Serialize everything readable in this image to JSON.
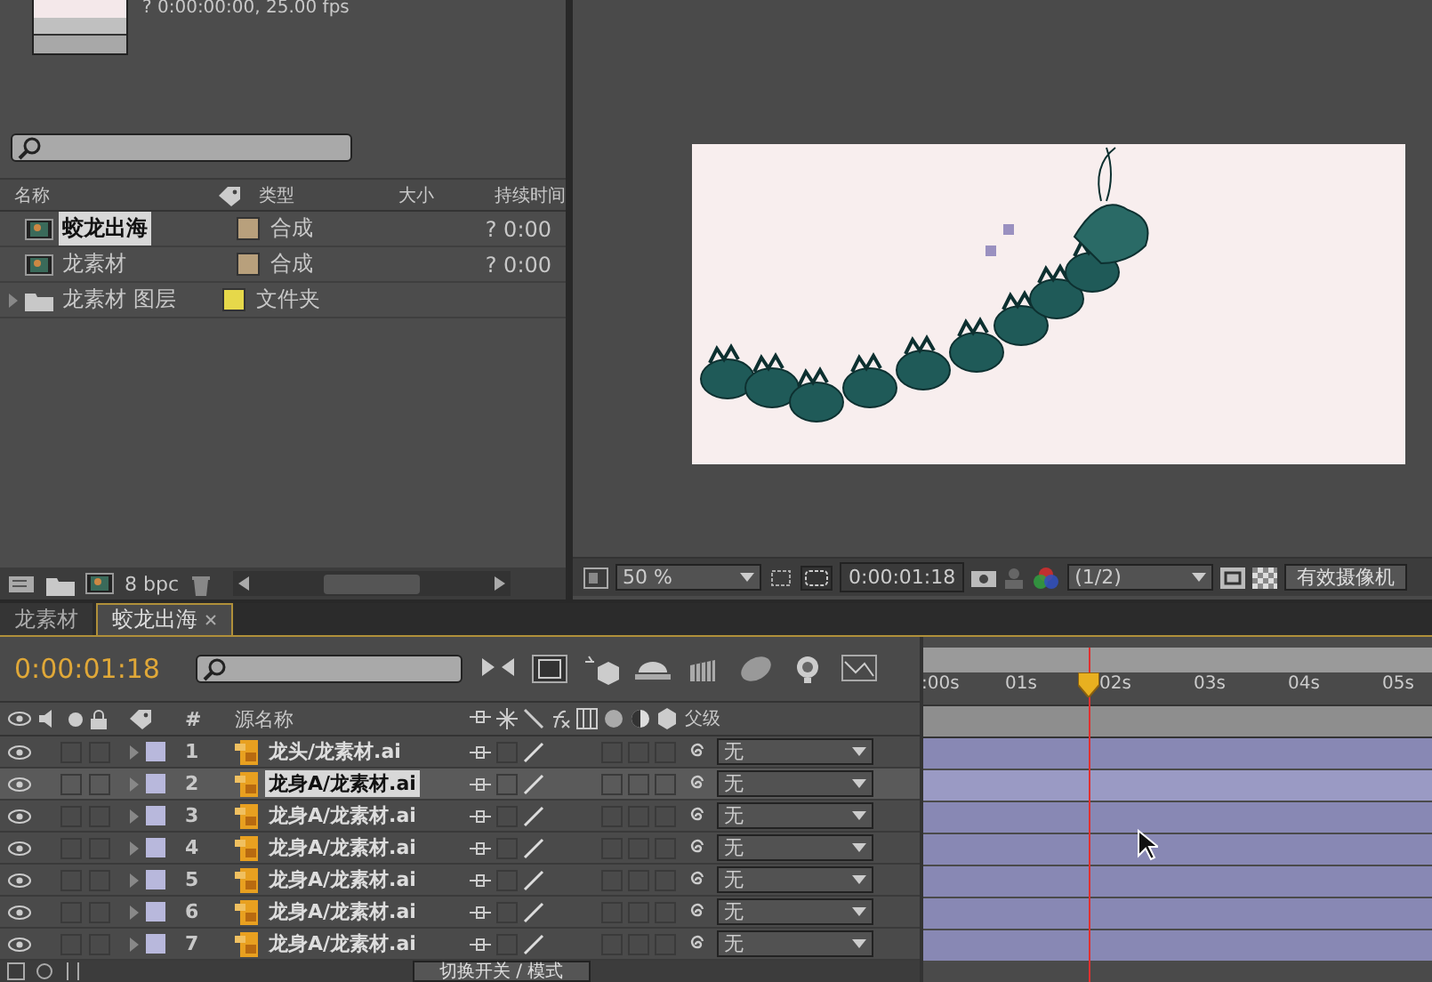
{
  "project": {
    "comp_info": "? 0:00:00:00, 25.00 fps",
    "columns": [
      "名称",
      "类型",
      "大小",
      "持续时间"
    ],
    "items": [
      {
        "name": "蛟龙出海",
        "kind": "comp",
        "type": "合成",
        "color": "#b8a07c",
        "duration": "? 0:00",
        "selected": true
      },
      {
        "name": "龙素材",
        "kind": "comp",
        "type": "合成",
        "color": "#b8a07c",
        "duration": "? 0:00",
        "selected": false
      },
      {
        "name": "龙素材 图层",
        "kind": "folder",
        "type": "文件夹",
        "color": "#e6d84a",
        "expanded": false,
        "selected": false
      }
    ],
    "bit_depth": "8 bpc"
  },
  "viewer": {
    "zoom": "50 %",
    "time": "0:00:01:18",
    "resolution": "(1/2)",
    "camera": "有效摄像机"
  },
  "timeline": {
    "tabs": [
      {
        "label": "龙素材",
        "selected": false
      },
      {
        "label": "蛟龙出海",
        "selected": true
      }
    ],
    "time": "0:00:01:18",
    "ruler": [
      ":00s",
      "01s",
      "02s",
      "03s",
      "04s",
      "05s"
    ],
    "playhead": {
      "level": 0.325
    },
    "columns": {
      "number": "#",
      "source_name": "源名称",
      "parent": "父级"
    },
    "layers": [
      {
        "number": "1",
        "name": "龙头/龙素材.ai",
        "visible": true,
        "selected": false,
        "parent": "无"
      },
      {
        "number": "2",
        "name": "龙身A/龙素材.ai",
        "visible": true,
        "selected": true,
        "parent": "无"
      },
      {
        "number": "3",
        "name": "龙身A/龙素材.ai",
        "visible": true,
        "selected": false,
        "parent": "无"
      },
      {
        "number": "4",
        "name": "龙身A/龙素材.ai",
        "visible": true,
        "selected": false,
        "parent": "无"
      },
      {
        "number": "5",
        "name": "龙身A/龙素材.ai",
        "visible": true,
        "selected": false,
        "parent": "无"
      },
      {
        "number": "6",
        "name": "龙身A/龙素材.ai",
        "visible": true,
        "selected": false,
        "parent": "无"
      },
      {
        "number": "7",
        "name": "龙身A/龙素材.ai",
        "visible": true,
        "selected": false,
        "parent": "无"
      }
    ],
    "mode_button": "切换开关 / 模式"
  }
}
